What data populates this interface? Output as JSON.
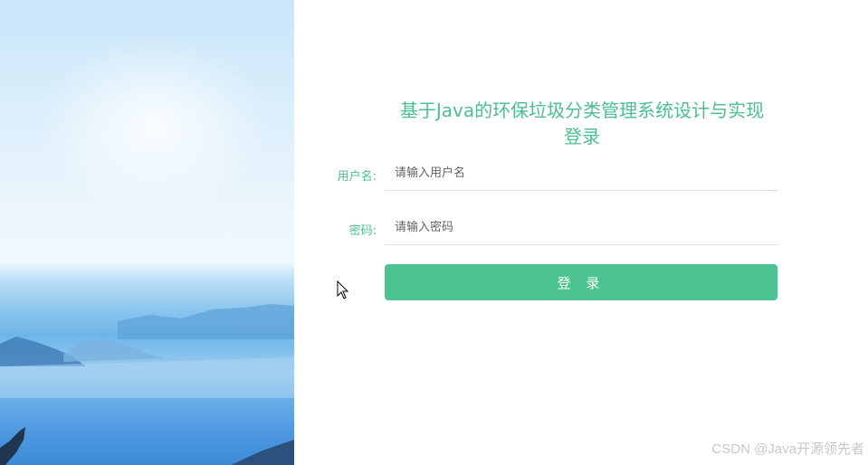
{
  "login": {
    "title": "基于Java的环保垃圾分类管理系统设计与实现登录",
    "username_label": "用户名:",
    "username_placeholder": "请输入用户名",
    "password_label": "密码:",
    "password_placeholder": "请输入密码",
    "submit_label": "登 录"
  },
  "watermark": "CSDN @Java开源领先者",
  "colors": {
    "accent": "#4cbf8e",
    "button": "#4cc491",
    "input_border": "#dcdfe6"
  }
}
